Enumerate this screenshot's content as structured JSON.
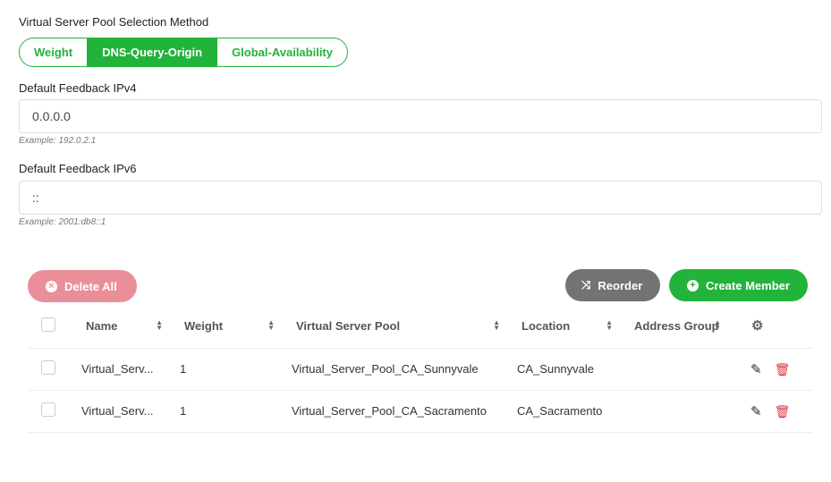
{
  "selection": {
    "label": "Virtual Server Pool Selection Method",
    "options": [
      "Weight",
      "DNS-Query-Origin",
      "Global-Availability"
    ],
    "selected": "DNS-Query-Origin"
  },
  "ipv4": {
    "label": "Default Feedback IPv4",
    "value": "0.0.0.0",
    "hint": "Example: 192.0.2.1"
  },
  "ipv6": {
    "label": "Default Feedback IPv6",
    "value": "::",
    "hint": "Example: 2001:db8::1"
  },
  "toolbar": {
    "delete_all": "Delete All",
    "reorder": "Reorder",
    "create_member": "Create Member"
  },
  "colors": {
    "green": "#22b33a",
    "delete": "#ea8f99",
    "reorder": "#737373",
    "danger": "#e02f3f"
  },
  "table": {
    "headers": [
      "Name",
      "Weight",
      "Virtual Server Pool",
      "Location",
      "Address Group"
    ],
    "rows": [
      {
        "name": "Virtual_Serv...",
        "weight": "1",
        "pool": "Virtual_Server_Pool_CA_Sunnyvale",
        "location": "CA_Sunnyvale",
        "address_group": ""
      },
      {
        "name": "Virtual_Serv...",
        "weight": "1",
        "pool": "Virtual_Server_Pool_CA_Sacramento",
        "location": "CA_Sacramento",
        "address_group": ""
      }
    ]
  }
}
